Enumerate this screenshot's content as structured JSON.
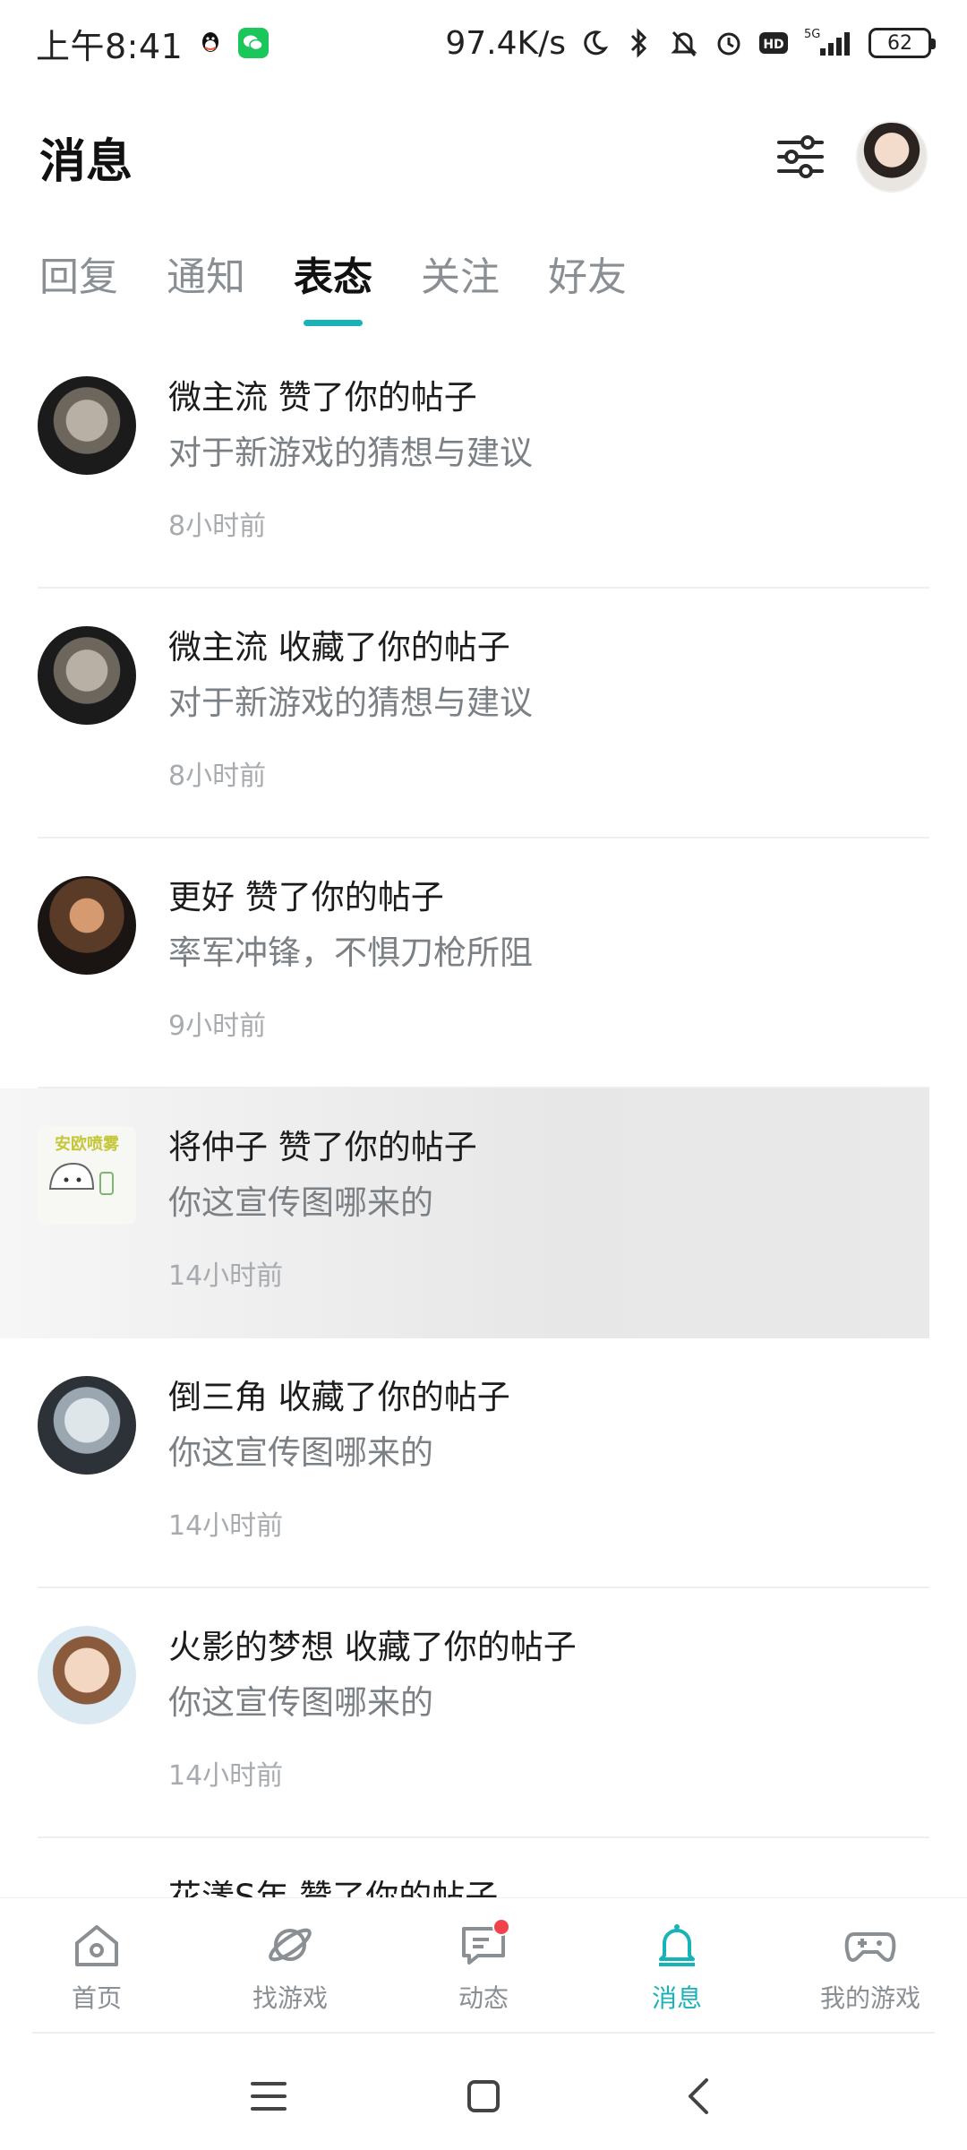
{
  "status_bar": {
    "time": "上午8:41",
    "net_speed": "97.4K/s",
    "network": "5G",
    "battery": "62"
  },
  "header": {
    "title": "消息"
  },
  "tabs": [
    {
      "label": "回复",
      "active": false
    },
    {
      "label": "通知",
      "active": false
    },
    {
      "label": "表态",
      "active": true
    },
    {
      "label": "关注",
      "active": false
    },
    {
      "label": "好友",
      "active": false
    }
  ],
  "messages": [
    {
      "title": "微主流 赞了你的帖子",
      "post": "对于新游戏的猜想与建议",
      "time": "8小时前",
      "avatar": "armor-avatar"
    },
    {
      "title": "微主流 收藏了你的帖子",
      "post": "对于新游戏的猜想与建议",
      "time": "8小时前",
      "avatar": "armor-avatar"
    },
    {
      "title": "更好 赞了你的帖子",
      "post": "率军冲锋，不惧刀枪所阻",
      "time": "9小时前",
      "avatar": "bearded-man-avatar"
    },
    {
      "title": "将仲子 赞了你的帖子",
      "post": "你这宣传图哪来的",
      "time": "14小时前",
      "avatar": "ghost-sticker-avatar",
      "avatar_text": "安欧喷雾"
    },
    {
      "title": "倒三角 收藏了你的帖子",
      "post": "你这宣传图哪来的",
      "time": "14小时前",
      "avatar": "anime-girl-avatar"
    },
    {
      "title": "火影的梦想 收藏了你的帖子",
      "post": "你这宣传图哪来的",
      "time": "14小时前",
      "avatar": "anime-boy-avatar"
    },
    {
      "title": "花漾S年 赞了你的帖子",
      "post": "",
      "time": "",
      "avatar": "dark-avatar"
    }
  ],
  "bottom_nav": [
    {
      "label": "首页",
      "icon": "home-icon",
      "active": false
    },
    {
      "label": "找游戏",
      "icon": "planet-icon",
      "active": false
    },
    {
      "label": "动态",
      "icon": "chat-icon",
      "active": false,
      "badge": true
    },
    {
      "label": "消息",
      "icon": "bell-icon",
      "active": true
    },
    {
      "label": "我的游戏",
      "icon": "gamepad-icon",
      "active": false
    }
  ],
  "colors": {
    "accent": "#17b3b9",
    "badge": "#f0434b",
    "muted": "#8a8f94"
  }
}
